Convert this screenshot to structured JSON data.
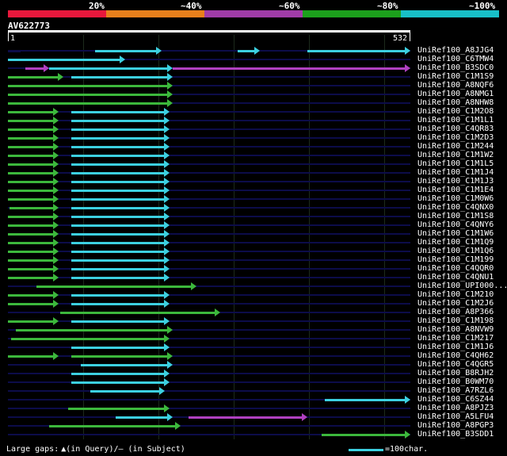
{
  "header": {
    "percent_labels": [
      "20%",
      "~40%",
      "~60%",
      "~80%",
      "~100%"
    ],
    "segment_colors": [
      "#e8183c",
      "#e8801c",
      "#a03ca8",
      "#1ca01c",
      "#18c0c8"
    ]
  },
  "query": {
    "name": "AV622773",
    "start": "1",
    "end": "532"
  },
  "colors": {
    "cyan": "#3cd0e0",
    "green": "#3cb83c",
    "magenta": "#b040c0",
    "track": "#0c0c4a"
  },
  "rows": [
    {
      "label": "UniRef100_A8JJG4",
      "hits": [
        {
          "s": 0,
          "e": 22,
          "c": "track"
        },
        {
          "s": 110,
          "e": 194,
          "c": "cyan"
        },
        {
          "s": 290,
          "e": 318,
          "c": "cyan"
        },
        {
          "s": 378,
          "e": 508,
          "c": "cyan"
        }
      ]
    },
    {
      "label": "UniRef100_C6TMW4",
      "hits": [
        {
          "s": 0,
          "e": 148,
          "c": "cyan"
        }
      ]
    },
    {
      "label": "UniRef100_B3SDC0",
      "hits": [
        {
          "s": 22,
          "e": 52,
          "c": "magenta"
        },
        {
          "s": 52,
          "e": 208,
          "c": "cyan"
        },
        {
          "s": 208,
          "e": 508,
          "c": "magenta"
        }
      ]
    },
    {
      "label": "UniRef100_C1M1S9",
      "hits": [
        {
          "s": 0,
          "e": 70,
          "c": "green"
        },
        {
          "s": 80,
          "e": 208,
          "c": "cyan"
        }
      ]
    },
    {
      "label": "UniRef100_A8NQF6",
      "hits": [
        {
          "s": 0,
          "e": 208,
          "c": "green"
        }
      ]
    },
    {
      "label": "UniRef100_A8NMG1",
      "hits": [
        {
          "s": 0,
          "e": 208,
          "c": "green"
        }
      ]
    },
    {
      "label": "UniRef100_A8NHW8",
      "hits": [
        {
          "s": 0,
          "e": 208,
          "c": "green"
        }
      ]
    },
    {
      "label": "UniRef100_C1M2O8",
      "hits": [
        {
          "s": 0,
          "e": 64,
          "c": "green"
        },
        {
          "s": 80,
          "e": 204,
          "c": "cyan"
        }
      ]
    },
    {
      "label": "UniRef100_C1M1L1",
      "hits": [
        {
          "s": 0,
          "e": 64,
          "c": "green"
        },
        {
          "s": 80,
          "e": 204,
          "c": "cyan"
        }
      ]
    },
    {
      "label": "UniRef100_C4QR83",
      "hits": [
        {
          "s": 0,
          "e": 64,
          "c": "green"
        },
        {
          "s": 80,
          "e": 204,
          "c": "cyan"
        }
      ]
    },
    {
      "label": "UniRef100_C1M2D3",
      "hits": [
        {
          "s": 0,
          "e": 64,
          "c": "green"
        },
        {
          "s": 80,
          "e": 204,
          "c": "cyan"
        }
      ]
    },
    {
      "label": "UniRef100_C1M244",
      "hits": [
        {
          "s": 0,
          "e": 64,
          "c": "green"
        },
        {
          "s": 80,
          "e": 204,
          "c": "cyan"
        }
      ]
    },
    {
      "label": "UniRef100_C1M1W2",
      "hits": [
        {
          "s": 0,
          "e": 64,
          "c": "green"
        },
        {
          "s": 80,
          "e": 204,
          "c": "cyan"
        }
      ]
    },
    {
      "label": "UniRef100_C1M1L5",
      "hits": [
        {
          "s": 0,
          "e": 64,
          "c": "green"
        },
        {
          "s": 80,
          "e": 204,
          "c": "cyan"
        }
      ]
    },
    {
      "label": "UniRef100_C1M1J4",
      "hits": [
        {
          "s": 0,
          "e": 64,
          "c": "green"
        },
        {
          "s": 80,
          "e": 204,
          "c": "cyan"
        }
      ]
    },
    {
      "label": "UniRef100_C1M1J3",
      "hits": [
        {
          "s": 0,
          "e": 64,
          "c": "green"
        },
        {
          "s": 80,
          "e": 204,
          "c": "cyan"
        }
      ]
    },
    {
      "label": "UniRef100_C1M1E4",
      "hits": [
        {
          "s": 0,
          "e": 64,
          "c": "green"
        },
        {
          "s": 80,
          "e": 204,
          "c": "cyan"
        }
      ]
    },
    {
      "label": "UniRef100_C1M0W6",
      "hits": [
        {
          "s": 0,
          "e": 64,
          "c": "green"
        },
        {
          "s": 80,
          "e": 204,
          "c": "cyan"
        }
      ]
    },
    {
      "label": "UniRef100_C4QNX0",
      "hits": [
        {
          "s": 2,
          "e": 64,
          "c": "green"
        },
        {
          "s": 80,
          "e": 204,
          "c": "cyan"
        }
      ]
    },
    {
      "label": "UniRef100_C1M1S8",
      "hits": [
        {
          "s": 0,
          "e": 64,
          "c": "green"
        },
        {
          "s": 80,
          "e": 204,
          "c": "cyan"
        }
      ]
    },
    {
      "label": "UniRef100_C4QNY6",
      "hits": [
        {
          "s": 0,
          "e": 64,
          "c": "green"
        },
        {
          "s": 80,
          "e": 204,
          "c": "cyan"
        }
      ]
    },
    {
      "label": "UniRef100_C1M1W6",
      "hits": [
        {
          "s": 0,
          "e": 64,
          "c": "green"
        },
        {
          "s": 80,
          "e": 204,
          "c": "cyan"
        }
      ]
    },
    {
      "label": "UniRef100_C1M1Q9",
      "hits": [
        {
          "s": 0,
          "e": 64,
          "c": "green"
        },
        {
          "s": 80,
          "e": 204,
          "c": "cyan"
        }
      ]
    },
    {
      "label": "UniRef100_C1M1Q6",
      "hits": [
        {
          "s": 0,
          "e": 64,
          "c": "green"
        },
        {
          "s": 80,
          "e": 204,
          "c": "cyan"
        }
      ]
    },
    {
      "label": "UniRef100_C1M199",
      "hits": [
        {
          "s": 0,
          "e": 64,
          "c": "green"
        },
        {
          "s": 80,
          "e": 204,
          "c": "cyan"
        }
      ]
    },
    {
      "label": "UniRef100_C4QQR0",
      "hits": [
        {
          "s": 0,
          "e": 64,
          "c": "green"
        },
        {
          "s": 80,
          "e": 204,
          "c": "cyan"
        }
      ]
    },
    {
      "label": "UniRef100_C4QNU1",
      "hits": [
        {
          "s": 0,
          "e": 64,
          "c": "green"
        },
        {
          "s": 80,
          "e": 204,
          "c": "cyan"
        }
      ]
    },
    {
      "label": "UniRef100_UPI000...",
      "hits": [
        {
          "s": 36,
          "e": 238,
          "c": "green"
        }
      ]
    },
    {
      "label": "UniRef100_C1M210",
      "hits": [
        {
          "s": 0,
          "e": 64,
          "c": "green"
        },
        {
          "s": 80,
          "e": 204,
          "c": "cyan"
        }
      ]
    },
    {
      "label": "UniRef100_C1M2J6",
      "hits": [
        {
          "s": 0,
          "e": 64,
          "c": "green"
        },
        {
          "s": 80,
          "e": 204,
          "c": "cyan"
        }
      ]
    },
    {
      "label": "UniRef100_A8P366",
      "hits": [
        {
          "s": 66,
          "e": 268,
          "c": "green"
        }
      ]
    },
    {
      "label": "UniRef100_C1M198",
      "hits": [
        {
          "s": 0,
          "e": 64,
          "c": "green"
        },
        {
          "s": 80,
          "e": 204,
          "c": "cyan"
        }
      ]
    },
    {
      "label": "UniRef100_A8NVW9",
      "hits": [
        {
          "s": 10,
          "e": 208,
          "c": "green"
        }
      ]
    },
    {
      "label": "UniRef100_C1M217",
      "hits": [
        {
          "s": 4,
          "e": 204,
          "c": "green"
        }
      ]
    },
    {
      "label": "UniRef100_C1M1J6",
      "hits": [
        {
          "s": 80,
          "e": 204,
          "c": "cyan"
        }
      ]
    },
    {
      "label": "UniRef100_C4QH62",
      "hits": [
        {
          "s": 0,
          "e": 64,
          "c": "green"
        },
        {
          "s": 80,
          "e": 208,
          "c": "green"
        }
      ]
    },
    {
      "label": "UniRef100_C4QGR5",
      "hits": [
        {
          "s": 92,
          "e": 208,
          "c": "cyan"
        }
      ]
    },
    {
      "label": "UniRef100_B8RJH2",
      "hits": [
        {
          "s": 80,
          "e": 204,
          "c": "cyan"
        }
      ]
    },
    {
      "label": "UniRef100_B0WM70",
      "hits": [
        {
          "s": 80,
          "e": 204,
          "c": "cyan"
        }
      ]
    },
    {
      "label": "UniRef100_A7RZL6",
      "hits": [
        {
          "s": 104,
          "e": 198,
          "c": "cyan"
        }
      ]
    },
    {
      "label": "UniRef100_C6SZ44",
      "hits": [
        {
          "s": 400,
          "e": 508,
          "c": "cyan"
        }
      ]
    },
    {
      "label": "UniRef100_A8PJZ3",
      "hits": [
        {
          "s": 76,
          "e": 204,
          "c": "green"
        }
      ]
    },
    {
      "label": "UniRef100_A5LFU4",
      "hits": [
        {
          "s": 136,
          "e": 208,
          "c": "cyan"
        },
        {
          "s": 228,
          "e": 378,
          "c": "magenta"
        }
      ]
    },
    {
      "label": "UniRef100_A8PGP3",
      "hits": [
        {
          "s": 52,
          "e": 218,
          "c": "green"
        }
      ]
    },
    {
      "label": "UniRef100_B3SDD1",
      "hits": [
        {
          "s": 396,
          "e": 508,
          "c": "green"
        }
      ]
    }
  ],
  "footer": {
    "gaps_text_1": "Large gaps:",
    "gaps_marker": "▲",
    "gaps_text_2": "(in Query)/– (in Subject)",
    "scale_text": "=100char."
  }
}
